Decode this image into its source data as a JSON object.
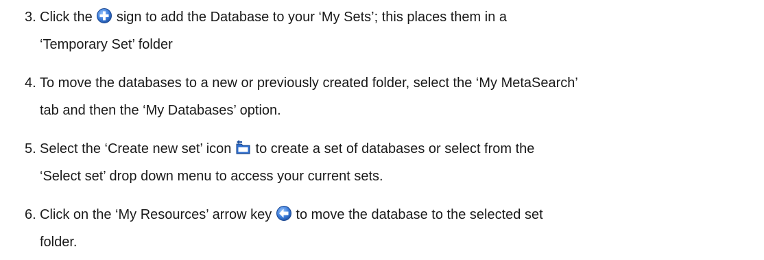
{
  "steps": [
    {
      "number": "3.",
      "line1_before": "Click the",
      "icon": "add-plus-circle-icon",
      "line1_after": "sign to add the Database to your ‘My Sets’; this places them in a",
      "line2": "‘Temporary Set’ folder"
    },
    {
      "number": "4.",
      "line1": "To move the databases to a new or previously created folder, select the ‘My MetaSearch’",
      "line2": "tab and then the ‘My Databases’ option."
    },
    {
      "number": "5.",
      "line1_before": "Select the ‘Create new set’ icon",
      "icon": "create-new-set-folder-icon",
      "line1_after": "to create a set of databases or select from the",
      "line2": "‘Select set’ drop down menu to access your current sets."
    },
    {
      "number": "6.",
      "line1_before": "Click on the ‘My Resources’ arrow key",
      "icon": "arrow-left-circle-icon",
      "line1_after": "to move the database to the selected set",
      "line2": "folder."
    }
  ],
  "colors": {
    "text": "#1a1a1a",
    "icon_blue": "#2f6fcf",
    "icon_blue_dark": "#1d4f9e"
  }
}
